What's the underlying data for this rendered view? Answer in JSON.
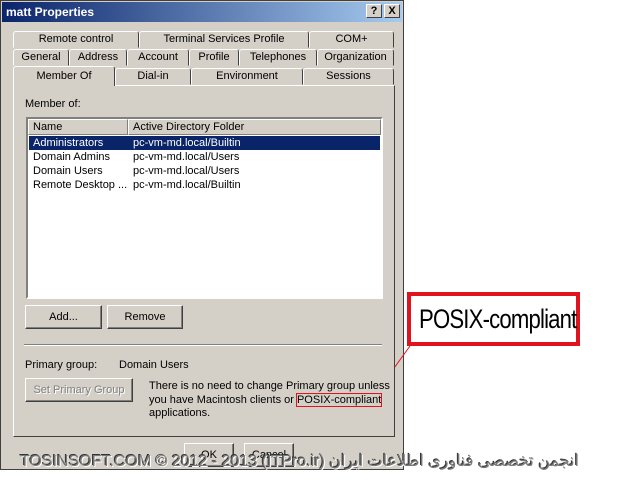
{
  "window": {
    "title": "matt Properties",
    "help_label": "?",
    "close_label": "X"
  },
  "tabs": {
    "row1": [
      "Remote control",
      "Terminal Services Profile",
      "COM+"
    ],
    "row2": [
      "General",
      "Address",
      "Account",
      "Profile",
      "Telephones",
      "Organization"
    ],
    "row3": [
      "Member Of",
      "Dial-in",
      "Environment",
      "Sessions"
    ],
    "active": "Member Of"
  },
  "member_of": {
    "label": "Member of:",
    "columns": [
      "Name",
      "Active Directory Folder"
    ],
    "rows": [
      {
        "name": "Administrators",
        "folder": "pc-vm-md.local/Builtin",
        "selected": true
      },
      {
        "name": "Domain Admins",
        "folder": "pc-vm-md.local/Users",
        "selected": false
      },
      {
        "name": "Domain Users",
        "folder": "pc-vm-md.local/Users",
        "selected": false
      },
      {
        "name": "Remote Desktop ...",
        "folder": "pc-vm-md.local/Builtin",
        "selected": false
      }
    ]
  },
  "buttons": {
    "add": "Add...",
    "remove": "Remove",
    "set_primary": "Set Primary Group",
    "ok": "OK",
    "cancel": "Cancel"
  },
  "primary_group": {
    "label": "Primary group:",
    "value": "Domain Users",
    "note_line1": "There is no need to change Primary group unless",
    "note_line2_prefix": "you have Macintosh clients or ",
    "note_highlight": "POSIX-compliant",
    "note_line3": "applications."
  },
  "callout": {
    "text": "POSIX-compliant",
    "color": "#e0141e"
  },
  "watermark": {
    "text": "TOSINSOFT.COM © 2012 - 2013 (ITPro.ir) انجمن تخصصی فناوری اطلاعات ایران"
  },
  "colors": {
    "titlebar_start": "#0a246a",
    "titlebar_end": "#a6caf0",
    "selection": "#0a246a",
    "face": "#d4d0c8"
  }
}
